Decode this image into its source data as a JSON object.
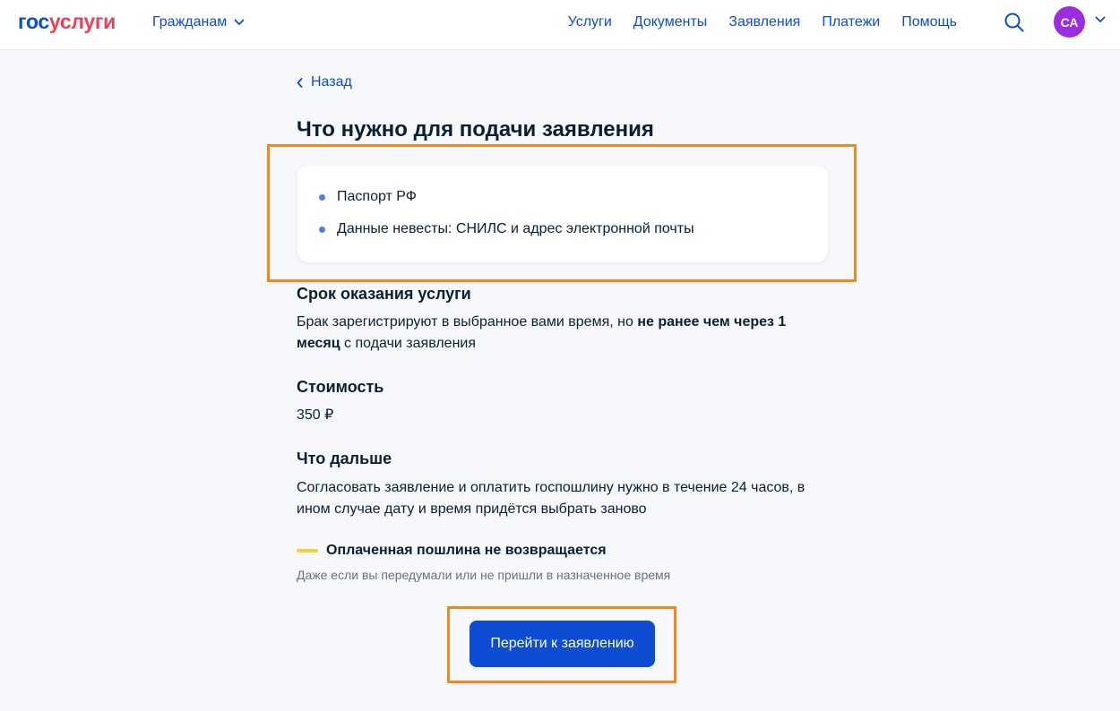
{
  "header": {
    "logo_part1": "гос",
    "logo_part2": "услуги",
    "citizens_label": "Гражданам",
    "nav": [
      "Услуги",
      "Документы",
      "Заявления",
      "Платежи",
      "Помощь"
    ],
    "avatar_initials": "СА"
  },
  "back_label": "Назад",
  "title": "Что нужно для подачи заявления",
  "requirements": [
    "Паспорт РФ",
    "Данные невесты: СНИЛС и адрес электронной почты"
  ],
  "term": {
    "title": "Срок оказания услуги",
    "text_before": "Брак зарегистрируют в выбранное вами время, но ",
    "text_bold": "не ранее чем через 1 месяц",
    "text_after": " с подачи заявления"
  },
  "cost": {
    "title": "Стоимость",
    "value": "350 ₽"
  },
  "next": {
    "title": "Что дальше",
    "text": "Согласовать заявление и оплатить госпошлину нужно в течение 24 часов, в ином случае дату и время придётся выбрать заново"
  },
  "warning": {
    "title": "Оплаченная пошлина не возвращается",
    "subtitle": "Даже если вы передумали или не пришли в назначенное время"
  },
  "cta_label": "Перейти к заявлению",
  "colors": {
    "brand_blue": "#0d4cd3",
    "brand_red": "#ee3f58",
    "avatar": "#9b2de0",
    "highlight_frame": "#f0891f",
    "warning_bar": "#f3d13b"
  }
}
